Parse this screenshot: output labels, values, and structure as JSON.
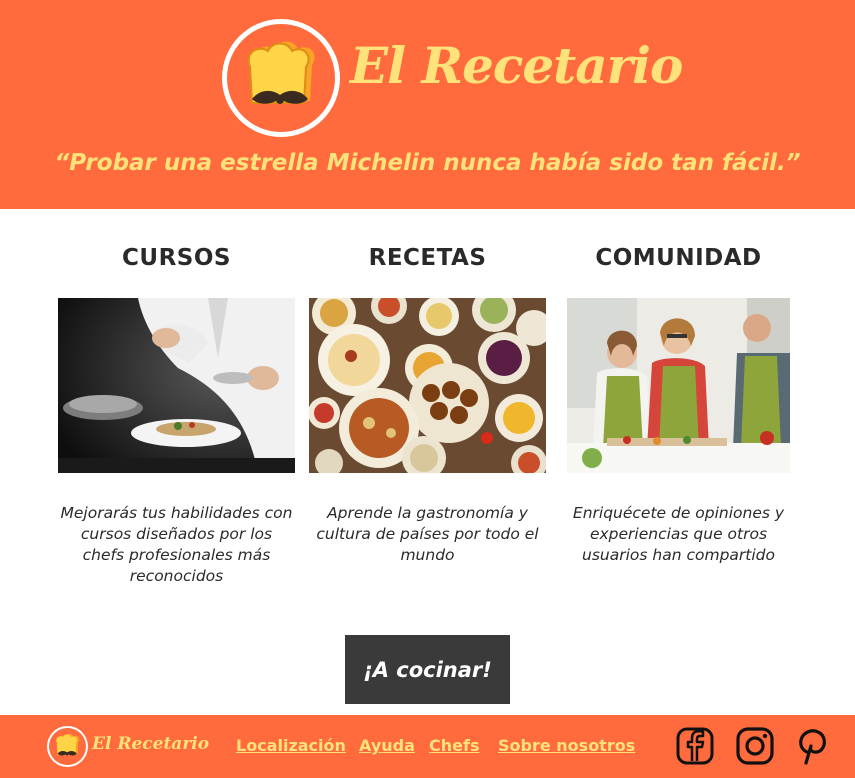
{
  "brand": {
    "name": "El Recetario",
    "tagline": "“Probar una estrella Michelin nunca había sido tan fácil.”"
  },
  "colors": {
    "accent": "#ff6b3d",
    "brand_text": "#ffe27a",
    "dark": "#3a3a3a"
  },
  "sections": [
    {
      "title": "CURSOS",
      "image": "chef-plating-dish-photo",
      "description": "Mejorarás tus habilidades con cursos diseñados por los chefs profesionales más reconocidos"
    },
    {
      "title": "RECETAS",
      "image": "international-dishes-table-photo",
      "description": "Aprende la gastronomía y cultura de países por todo el mundo"
    },
    {
      "title": "COMUNIDAD",
      "image": "people-cooking-together-photo",
      "description": "Enriquécete de opiniones y experiencias que otros usuarios han compartido"
    }
  ],
  "cta": {
    "label": "¡A cocinar!"
  },
  "footer": {
    "brand": "El Recetario",
    "links": [
      "Localización",
      "Ayuda",
      "Chefs",
      "Sobre nosotros"
    ],
    "social": [
      "facebook-icon",
      "instagram-icon",
      "pinterest-icon"
    ]
  }
}
